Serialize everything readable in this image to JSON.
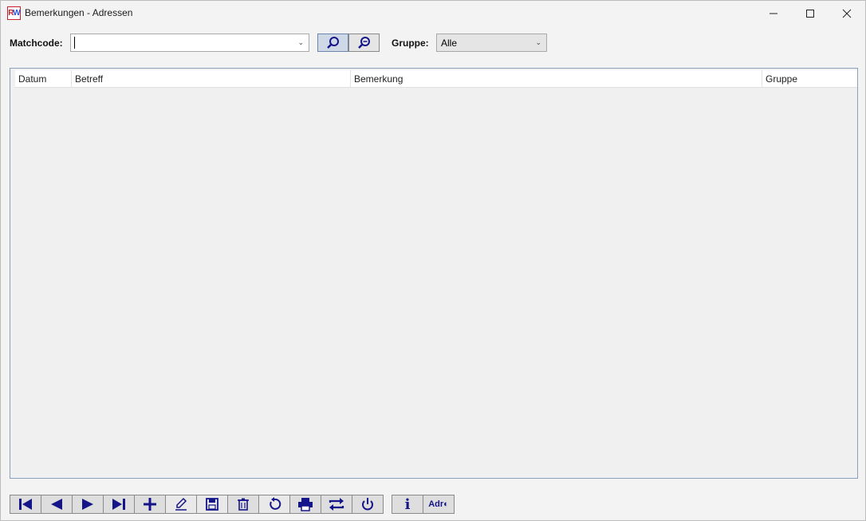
{
  "window": {
    "title": "Bemerkungen - Adressen",
    "icon_text_r": "R",
    "icon_text_w": "W"
  },
  "search": {
    "matchcode_label": "Matchcode:",
    "matchcode_value": "",
    "gruppe_label": "Gruppe:",
    "gruppe_value": "Alle",
    "buttons": [
      "search-icon",
      "zoom-out-icon"
    ]
  },
  "list": {
    "columns": [
      "Datum",
      "Betreff",
      "Bemerkung",
      "Gruppe"
    ],
    "rows": []
  },
  "toolbar": {
    "buttons": [
      "first-record-icon",
      "previous-record-icon",
      "next-record-icon",
      "last-record-icon",
      "add-icon",
      "edit-icon",
      "save-icon",
      "delete-icon",
      "refresh-icon",
      "print-icon",
      "swap-icon",
      "power-icon",
      "info-icon",
      "adr-icon"
    ],
    "info_label": "i",
    "adr_label": "Adr"
  },
  "colors": {
    "icon_blue": "#15158a",
    "accent_red": "#c6202e",
    "border_blue": "#8aa0bd"
  }
}
